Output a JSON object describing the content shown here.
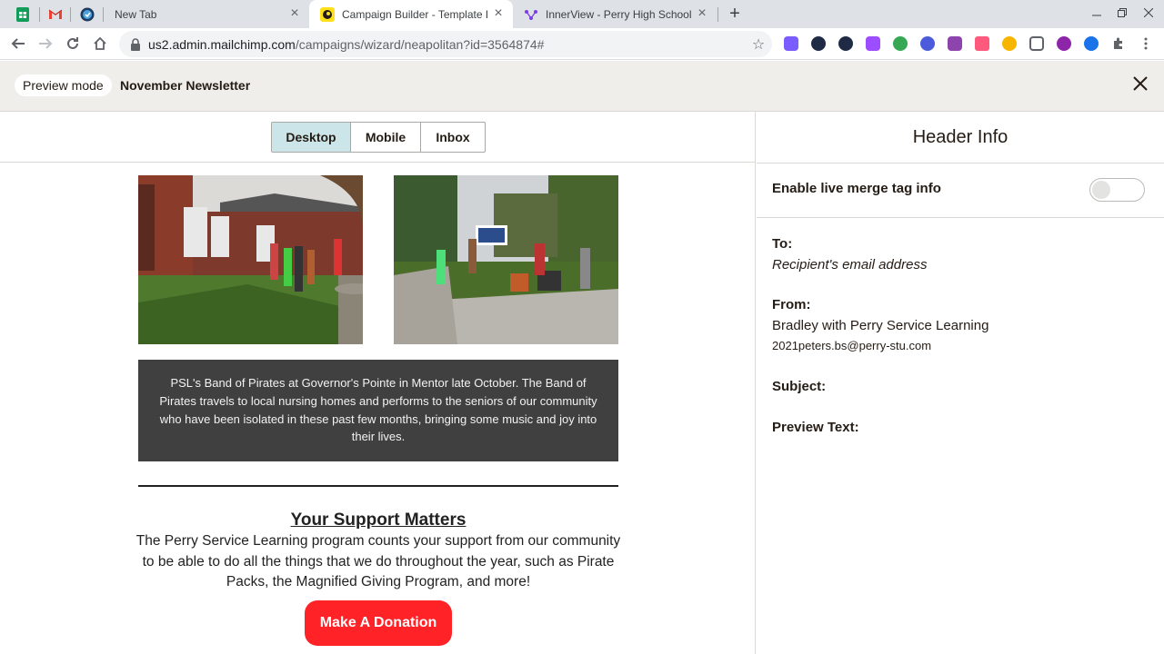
{
  "browser": {
    "tabs": [
      {
        "label": "New Tab",
        "active": false
      },
      {
        "label": "Campaign Builder - Template De",
        "active": true
      },
      {
        "label": "InnerView - Perry High School",
        "active": false
      }
    ],
    "pinned_tabs": [
      "google-sheets-icon",
      "gmail-icon",
      "clock-extension-icon"
    ],
    "url_host": "us2.admin.mailchimp.com",
    "url_path": "/campaigns/wizard/neapolitan?id=3564874#",
    "close_glyph": "×",
    "new_tab_glyph": "+",
    "star_glyph": "☆"
  },
  "app_header": {
    "mode_badge": "Preview mode",
    "campaign_name": "November Newsletter"
  },
  "device_tabs": [
    {
      "label": "Desktop",
      "selected": true
    },
    {
      "label": "Mobile",
      "selected": false
    },
    {
      "label": "Inbox",
      "selected": false
    }
  ],
  "email": {
    "caption": "PSL's Band of Pirates at Governor's Pointe in Mentor late October. The Band of Pirates travels to local nursing homes and performs to the seniors of our community who have been isolated in these past few months, bringing some music and joy into their lives.",
    "support_title": "Your Support Matters",
    "support_body": "The Perry Service Learning program counts your support from our community to be able to do all the things that we do throughout the year, such as Pirate Packs, the Magnified Giving Program, and more!",
    "donate_label": "Make A Donation"
  },
  "side_panel": {
    "title": "Header Info",
    "merge_toggle_label": "Enable live merge tag info",
    "merge_toggle_on": false,
    "to_label": "To:",
    "to_value": "Recipient's email address",
    "from_label": "From:",
    "from_name": "Bradley with Perry Service Learning",
    "from_email": "2021peters.bs@perry-stu.com",
    "subject_label": "Subject:",
    "preview_label": "Preview Text:"
  },
  "colors": {
    "donate_button": "#ff2226",
    "desktop_selected": "#cbe5e8",
    "caption_background": "#404040",
    "app_header_bg": "#efeeea"
  }
}
